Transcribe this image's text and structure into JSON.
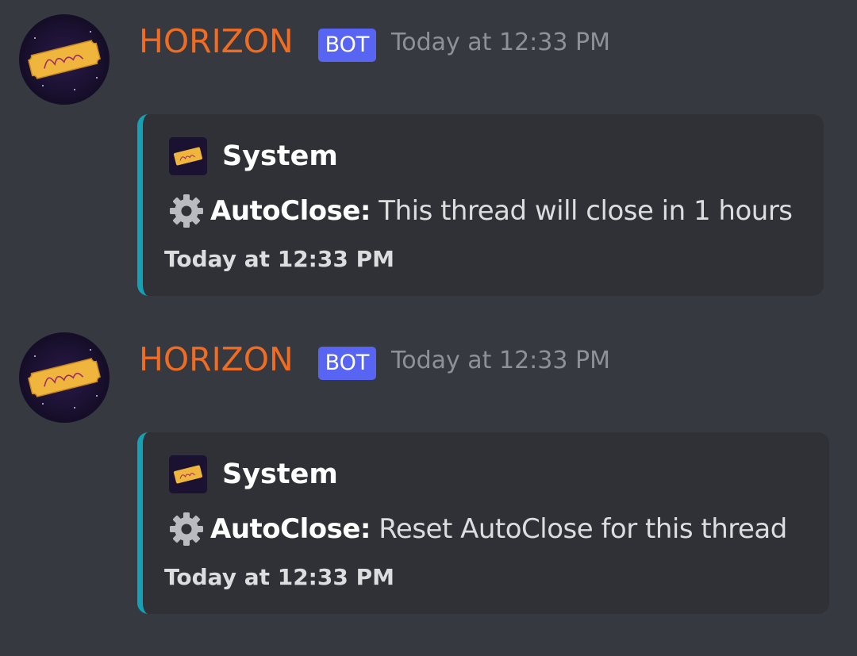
{
  "colors": {
    "background": "#36393f",
    "embed_background": "#2f3136",
    "embed_accent": "#14a1b6",
    "username": "#ef6c22",
    "bot_tag": "#5865f2",
    "timestamp": "#8e9297"
  },
  "messages": [
    {
      "author": "HORIZON",
      "tag": "BOT",
      "timestamp": "Today at 12:33 PM",
      "avatar_icon": "horizon-ticket-avatar",
      "embed": {
        "author_name": "System",
        "icon": "gear-icon",
        "label": "AutoClose:",
        "text": " This thread will close in 1 hours",
        "footer": "Today at 12:33 PM"
      }
    },
    {
      "author": "HORIZON",
      "tag": "BOT",
      "timestamp": "Today at 12:33 PM",
      "avatar_icon": "horizon-ticket-avatar",
      "embed": {
        "author_name": "System",
        "icon": "gear-icon",
        "label": "AutoClose:",
        "text": " Reset AutoClose for this thread",
        "footer": "Today at 12:33 PM"
      }
    }
  ]
}
